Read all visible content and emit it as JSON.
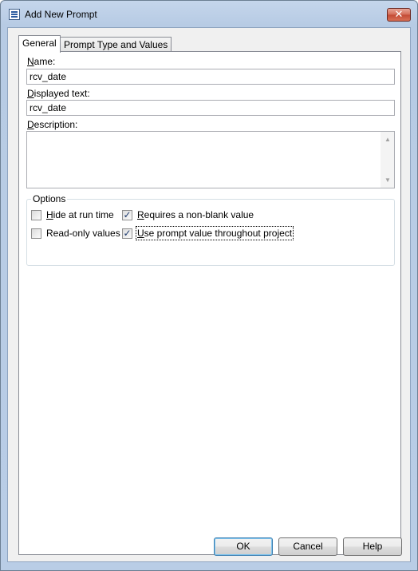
{
  "window": {
    "title": "Add New Prompt"
  },
  "tabs": [
    {
      "label": "General"
    },
    {
      "label": "Prompt Type and Values"
    }
  ],
  "fields": {
    "name": {
      "label_mnemonic": "N",
      "label_rest": "ame:",
      "value": "rcv_date"
    },
    "displayed_text": {
      "label_mnemonic": "D",
      "label_rest": "isplayed text:",
      "value": "rcv_date"
    },
    "description": {
      "label_mnemonic": "D",
      "label_rest": "escription:",
      "value": ""
    }
  },
  "options": {
    "title": "Options",
    "items": [
      {
        "mnemonic": "H",
        "rest": "ide at run time",
        "checked": false
      },
      {
        "mnemonic": "R",
        "rest": "equires a non-blank value",
        "checked": true
      },
      {
        "mnemonic": "",
        "rest": "Read-only values",
        "checked": false
      },
      {
        "mnemonic": "U",
        "rest": "se prompt value throughout project",
        "checked": true
      }
    ]
  },
  "buttons": {
    "ok": "OK",
    "cancel": "Cancel",
    "help": "Help"
  },
  "icons": {
    "close": "close-icon",
    "app": "prompt-list-icon",
    "check": "✓"
  }
}
